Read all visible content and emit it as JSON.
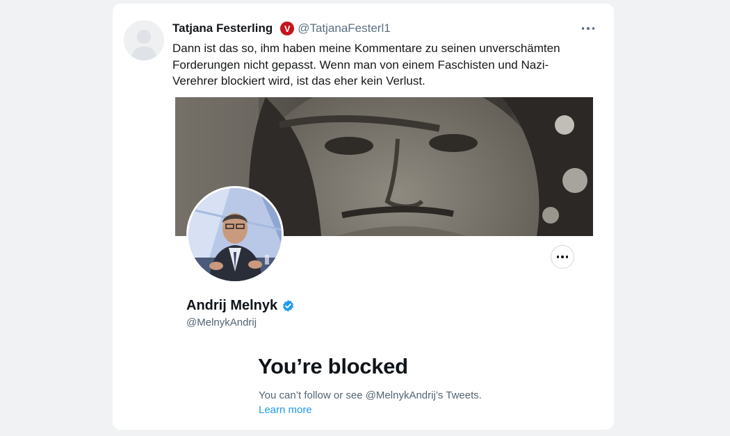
{
  "tweet": {
    "author_name": "Tatjana Festerling",
    "badge_letter": "V",
    "handle": "@TatjanaFesterl1",
    "text": "Dann ist das so, ihm haben meine Kommentare zu seinen unverschämten\nForderungen nicht gepasst. Wenn man von einem Faschisten und Nazi-\nVerehrer blockiert wird, ist das eher kein Verlust."
  },
  "embedded_profile": {
    "name": "Andrij Melnyk",
    "handle": "@MelnykAndrij",
    "blocked_title": "You’re blocked",
    "blocked_description": "You can’t follow or see @MelnykAndrij’s Tweets.",
    "learn_more": "Learn more"
  },
  "colors": {
    "page_background": "#f0f2f4",
    "card_background": "#ffffff",
    "verified_blue": "#1d9bf0",
    "badge_red": "#c4161c",
    "link_blue": "#1d9bf0"
  },
  "icons": {
    "more": "more-horizontal-icon",
    "verified": "verified-check-icon",
    "badge": "v-badge-icon"
  }
}
